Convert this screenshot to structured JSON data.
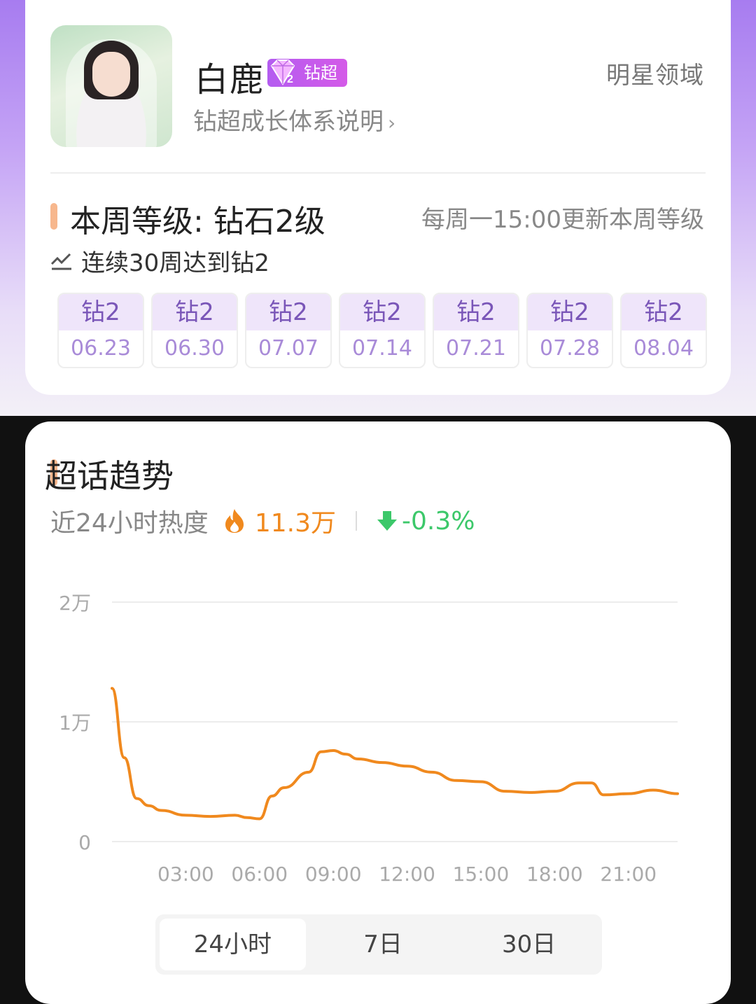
{
  "profile": {
    "name": "白鹿",
    "badge_label": "钻超",
    "growth_link": "钻超成长体系说明",
    "domain_label": "明星领域"
  },
  "level": {
    "title": "本周等级: 钻石2级",
    "update_note": "每周一15:00更新本周等级",
    "streak": "连续30周达到钻2",
    "weeks": [
      {
        "level": "钻2",
        "date": "06.23"
      },
      {
        "level": "钻2",
        "date": "06.30"
      },
      {
        "level": "钻2",
        "date": "07.07"
      },
      {
        "level": "钻2",
        "date": "07.14"
      },
      {
        "level": "钻2",
        "date": "07.21"
      },
      {
        "level": "钻2",
        "date": "07.28"
      },
      {
        "level": "钻2",
        "date": "08.04"
      }
    ]
  },
  "trend": {
    "title": "超话趋势",
    "heat_label": "近24小时热度",
    "heat_value": "11.3万",
    "change": "-0.3%",
    "tabs": [
      "24小时",
      "7日",
      "30日"
    ],
    "active_tab": "24小时"
  },
  "colors": {
    "accent_orange": "#f0891e",
    "down_green": "#3cc86a",
    "purple": "#7a56b8"
  },
  "chart_data": {
    "type": "line",
    "ytick_labels": [
      "0",
      "1万",
      "2万"
    ],
    "yticks": [
      0,
      10000,
      20000
    ],
    "ylim": [
      0,
      20000
    ],
    "xtick_labels": [
      "03:00",
      "06:00",
      "09:00",
      "12:00",
      "15:00",
      "18:00",
      "21:00"
    ],
    "xticks": [
      3,
      6,
      9,
      12,
      15,
      18,
      21
    ],
    "xlim": [
      0,
      23
    ],
    "grid": true,
    "series": [
      {
        "x": [
          0,
          0.5,
          1,
          1.5,
          2,
          3,
          4,
          5,
          5.5,
          6,
          6.5,
          7,
          8,
          8.5,
          9,
          9.5,
          10,
          11,
          12,
          13,
          14,
          15,
          16,
          17,
          18,
          19,
          19.5,
          20,
          21,
          22,
          23
        ],
        "values": [
          12800,
          7000,
          3600,
          3000,
          2600,
          2200,
          2100,
          2200,
          2000,
          1900,
          3800,
          4500,
          5800,
          7500,
          7600,
          7300,
          6900,
          6600,
          6300,
          5800,
          5100,
          5000,
          4200,
          4100,
          4200,
          4900,
          4900,
          3900,
          4000,
          4300,
          4000
        ]
      }
    ]
  }
}
